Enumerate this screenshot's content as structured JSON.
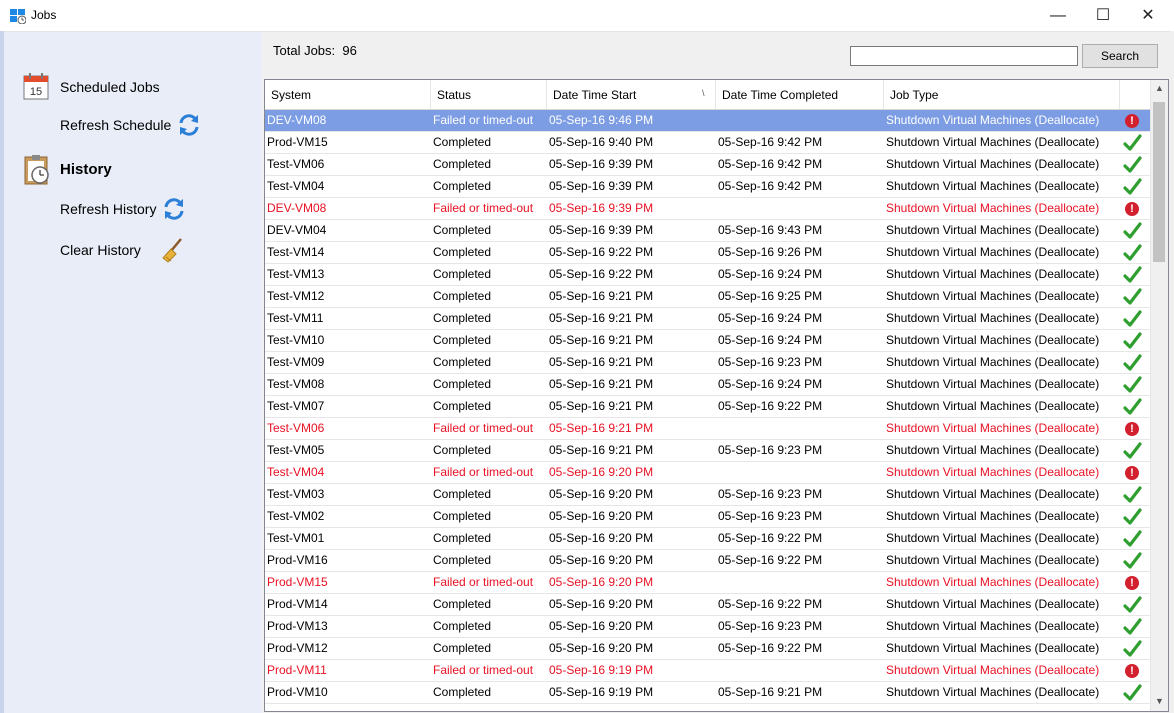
{
  "window": {
    "title": "Jobs",
    "min_glyph": "—",
    "max_glyph": "☐",
    "close_glyph": "✕"
  },
  "sidebar": {
    "scheduled_jobs": "Scheduled Jobs",
    "calendar_day": "15",
    "refresh_schedule": "Refresh Schedule",
    "history": "History",
    "refresh_history": "Refresh History",
    "clear_history": "Clear History"
  },
  "toolbar": {
    "total_label": "Total Jobs:",
    "total_value": "96",
    "search_value": "",
    "search_button": "Search"
  },
  "table": {
    "columns": [
      "System",
      "Status",
      "Date Time Start",
      "Date Time Completed",
      "Job Type"
    ],
    "sort_indicator": "\\",
    "rows": [
      [
        "DEV-VM08",
        "Failed or timed-out",
        "05-Sep-16 9:46 PM",
        "",
        "Shutdown Virtual Machines (Deallocate)",
        "error"
      ],
      [
        "Prod-VM15",
        "Completed",
        "05-Sep-16 9:40 PM",
        "05-Sep-16 9:42 PM",
        "Shutdown Virtual Machines (Deallocate)",
        "ok"
      ],
      [
        "Test-VM06",
        "Completed",
        "05-Sep-16 9:39 PM",
        "05-Sep-16 9:42 PM",
        "Shutdown Virtual Machines (Deallocate)",
        "ok"
      ],
      [
        "Test-VM04",
        "Completed",
        "05-Sep-16 9:39 PM",
        "05-Sep-16 9:42 PM",
        "Shutdown Virtual Machines (Deallocate)",
        "ok"
      ],
      [
        "DEV-VM08",
        "Failed or timed-out",
        "05-Sep-16 9:39 PM",
        "",
        "Shutdown Virtual Machines (Deallocate)",
        "error"
      ],
      [
        "DEV-VM04",
        "Completed",
        "05-Sep-16 9:39 PM",
        "05-Sep-16 9:43 PM",
        "Shutdown Virtual Machines (Deallocate)",
        "ok"
      ],
      [
        "Test-VM14",
        "Completed",
        "05-Sep-16 9:22 PM",
        "05-Sep-16 9:26 PM",
        "Shutdown Virtual Machines (Deallocate)",
        "ok"
      ],
      [
        "Test-VM13",
        "Completed",
        "05-Sep-16 9:22 PM",
        "05-Sep-16 9:24 PM",
        "Shutdown Virtual Machines (Deallocate)",
        "ok"
      ],
      [
        "Test-VM12",
        "Completed",
        "05-Sep-16 9:21 PM",
        "05-Sep-16 9:25 PM",
        "Shutdown Virtual Machines (Deallocate)",
        "ok"
      ],
      [
        "Test-VM11",
        "Completed",
        "05-Sep-16 9:21 PM",
        "05-Sep-16 9:24 PM",
        "Shutdown Virtual Machines (Deallocate)",
        "ok"
      ],
      [
        "Test-VM10",
        "Completed",
        "05-Sep-16 9:21 PM",
        "05-Sep-16 9:24 PM",
        "Shutdown Virtual Machines (Deallocate)",
        "ok"
      ],
      [
        "Test-VM09",
        "Completed",
        "05-Sep-16 9:21 PM",
        "05-Sep-16 9:23 PM",
        "Shutdown Virtual Machines (Deallocate)",
        "ok"
      ],
      [
        "Test-VM08",
        "Completed",
        "05-Sep-16 9:21 PM",
        "05-Sep-16 9:24 PM",
        "Shutdown Virtual Machines (Deallocate)",
        "ok"
      ],
      [
        "Test-VM07",
        "Completed",
        "05-Sep-16 9:21 PM",
        "05-Sep-16 9:22 PM",
        "Shutdown Virtual Machines (Deallocate)",
        "ok"
      ],
      [
        "Test-VM06",
        "Failed or timed-out",
        "05-Sep-16 9:21 PM",
        "",
        "Shutdown Virtual Machines (Deallocate)",
        "error"
      ],
      [
        "Test-VM05",
        "Completed",
        "05-Sep-16 9:21 PM",
        "05-Sep-16 9:23 PM",
        "Shutdown Virtual Machines (Deallocate)",
        "ok"
      ],
      [
        "Test-VM04",
        "Failed or timed-out",
        "05-Sep-16 9:20 PM",
        "",
        "Shutdown Virtual Machines (Deallocate)",
        "error"
      ],
      [
        "Test-VM03",
        "Completed",
        "05-Sep-16 9:20 PM",
        "05-Sep-16 9:23 PM",
        "Shutdown Virtual Machines (Deallocate)",
        "ok"
      ],
      [
        "Test-VM02",
        "Completed",
        "05-Sep-16 9:20 PM",
        "05-Sep-16 9:23 PM",
        "Shutdown Virtual Machines (Deallocate)",
        "ok"
      ],
      [
        "Test-VM01",
        "Completed",
        "05-Sep-16 9:20 PM",
        "05-Sep-16 9:22 PM",
        "Shutdown Virtual Machines (Deallocate)",
        "ok"
      ],
      [
        "Prod-VM16",
        "Completed",
        "05-Sep-16 9:20 PM",
        "05-Sep-16 9:22 PM",
        "Shutdown Virtual Machines (Deallocate)",
        "ok"
      ],
      [
        "Prod-VM15",
        "Failed or timed-out",
        "05-Sep-16 9:20 PM",
        "",
        "Shutdown Virtual Machines (Deallocate)",
        "error"
      ],
      [
        "Prod-VM14",
        "Completed",
        "05-Sep-16 9:20 PM",
        "05-Sep-16 9:22 PM",
        "Shutdown Virtual Machines (Deallocate)",
        "ok"
      ],
      [
        "Prod-VM13",
        "Completed",
        "05-Sep-16 9:20 PM",
        "05-Sep-16 9:23 PM",
        "Shutdown Virtual Machines (Deallocate)",
        "ok"
      ],
      [
        "Prod-VM12",
        "Completed",
        "05-Sep-16 9:20 PM",
        "05-Sep-16 9:22 PM",
        "Shutdown Virtual Machines (Deallocate)",
        "ok"
      ],
      [
        "Prod-VM11",
        "Failed or timed-out",
        "05-Sep-16 9:19 PM",
        "",
        "Shutdown Virtual Machines (Deallocate)",
        "error"
      ],
      [
        "Prod-VM10",
        "Completed",
        "05-Sep-16 9:19 PM",
        "05-Sep-16 9:21 PM",
        "Shutdown Virtual Machines (Deallocate)",
        "ok"
      ]
    ],
    "selected_row": 0,
    "status_icon_names": {
      "ok": "check-icon",
      "error": "error-icon"
    },
    "error_glyph": "!"
  },
  "colors": {
    "selected_row": "#7c9de3",
    "failed_text": "#e81123",
    "check_green": "#2e9e2e",
    "error_red": "#d2202f",
    "sidebar_bg": "#e8edf8"
  }
}
